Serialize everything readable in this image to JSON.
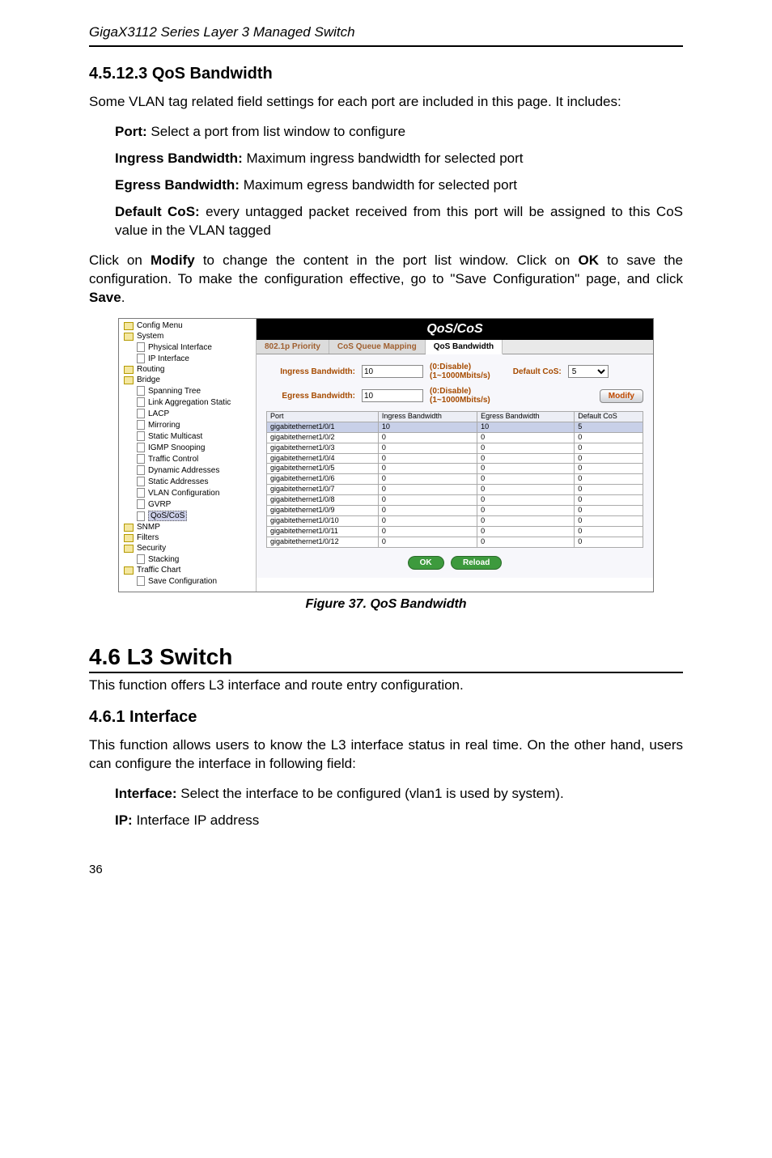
{
  "header": {
    "running": "GigaX3112 Series Layer 3 Managed Switch"
  },
  "s1": {
    "num_title": "4.5.12.3  QoS Bandwidth",
    "intro": "Some VLAN tag related field settings for each port are included in this page. It includes:",
    "port_label": "Port:",
    "port_text": " Select a port from list window to configure",
    "ing_label": "Ingress Bandwidth:",
    "ing_text": " Maximum ingress bandwidth for selected port",
    "egr_label": "Egress Bandwidth:",
    "egr_text": " Maximum egress bandwidth for selected port",
    "dcos_label": "Default CoS:",
    "dcos_text": " every untagged packet received from this port will be assigned to this CoS value in the VLAN tagged",
    "para2_a": "Click on ",
    "para2_b": "Modify",
    "para2_c": " to change the content in the port list window. Click on ",
    "para2_d": "OK",
    "para2_e": " to save the configuration. To make the configuration effective, go to \"Save Configuration\" page, and click ",
    "para2_f": "Save",
    "para2_g": "."
  },
  "fig": {
    "caption": "Figure 37. QoS Bandwidth"
  },
  "shot": {
    "tree": {
      "config_menu": "Config Menu",
      "system": "System",
      "phys": "Physical Interface",
      "ipif": "IP Interface",
      "routing": "Routing",
      "bridge": "Bridge",
      "spanning": "Spanning Tree",
      "lag": "Link Aggregation Static",
      "lacp": "LACP",
      "mirroring": "Mirroring",
      "static_mc": "Static Multicast",
      "igmp": "IGMP Snooping",
      "traffic": "Traffic Control",
      "dyn": "Dynamic Addresses",
      "static_addr": "Static Addresses",
      "vlan": "VLAN Configuration",
      "gvrp": "GVRP",
      "qos": "QoS/CoS",
      "snmp": "SNMP",
      "filters": "Filters",
      "security": "Security",
      "stacking": "Stacking",
      "chart": "Traffic Chart",
      "save": "Save Configuration"
    },
    "title": "QoS/CoS",
    "tabs": {
      "t1": "802.1p Priority",
      "t2": "CoS Queue Mapping",
      "t3": "QoS Bandwidth"
    },
    "cfg": {
      "ing_label": "Ingress Bandwidth:",
      "ing_val": "10",
      "note1a": "(0:Disable)",
      "note1b": "(1~1000Mbits/s)",
      "dcos_label": "Default CoS:",
      "dcos_val": "5",
      "egr_label": "Egress Bandwidth:",
      "egr_val": "10",
      "note2a": "(0:Disable)",
      "note2b": "(1~1000Mbits/s)",
      "modify": "Modify"
    },
    "table": {
      "h_port": "Port",
      "h_ing": "Ingress Bandwidth",
      "h_egr": "Egress Bandwidth",
      "h_cos": "Default CoS",
      "rows": [
        {
          "port": "gigabitethernet1/0/1",
          "ing": "10",
          "egr": "10",
          "cos": "5",
          "sel": true
        },
        {
          "port": "gigabitethernet1/0/2",
          "ing": "0",
          "egr": "0",
          "cos": "0",
          "sel": false
        },
        {
          "port": "gigabitethernet1/0/3",
          "ing": "0",
          "egr": "0",
          "cos": "0",
          "sel": false
        },
        {
          "port": "gigabitethernet1/0/4",
          "ing": "0",
          "egr": "0",
          "cos": "0",
          "sel": false
        },
        {
          "port": "gigabitethernet1/0/5",
          "ing": "0",
          "egr": "0",
          "cos": "0",
          "sel": false
        },
        {
          "port": "gigabitethernet1/0/6",
          "ing": "0",
          "egr": "0",
          "cos": "0",
          "sel": false
        },
        {
          "port": "gigabitethernet1/0/7",
          "ing": "0",
          "egr": "0",
          "cos": "0",
          "sel": false
        },
        {
          "port": "gigabitethernet1/0/8",
          "ing": "0",
          "egr": "0",
          "cos": "0",
          "sel": false
        },
        {
          "port": "gigabitethernet1/0/9",
          "ing": "0",
          "egr": "0",
          "cos": "0",
          "sel": false
        },
        {
          "port": "gigabitethernet1/0/10",
          "ing": "0",
          "egr": "0",
          "cos": "0",
          "sel": false
        },
        {
          "port": "gigabitethernet1/0/11",
          "ing": "0",
          "egr": "0",
          "cos": "0",
          "sel": false
        },
        {
          "port": "gigabitethernet1/0/12",
          "ing": "0",
          "egr": "0",
          "cos": "0",
          "sel": false
        }
      ]
    },
    "buttons": {
      "ok": "OK",
      "reload": "Reload"
    }
  },
  "s2": {
    "title": "4.6 L3 Switch",
    "intro": "This function offers L3 interface and route entry configuration.",
    "sub_title": "4.6.1   Interface",
    "para": "This function allows users to know the L3 interface status in real time. On the other hand, users can configure the interface in following field:",
    "if_label": "Interface:",
    "if_text": " Select the interface to be configured (vlan1 is used by system).",
    "ip_label": "IP:",
    "ip_text": " Interface IP address"
  },
  "footer": {
    "page": "36"
  }
}
